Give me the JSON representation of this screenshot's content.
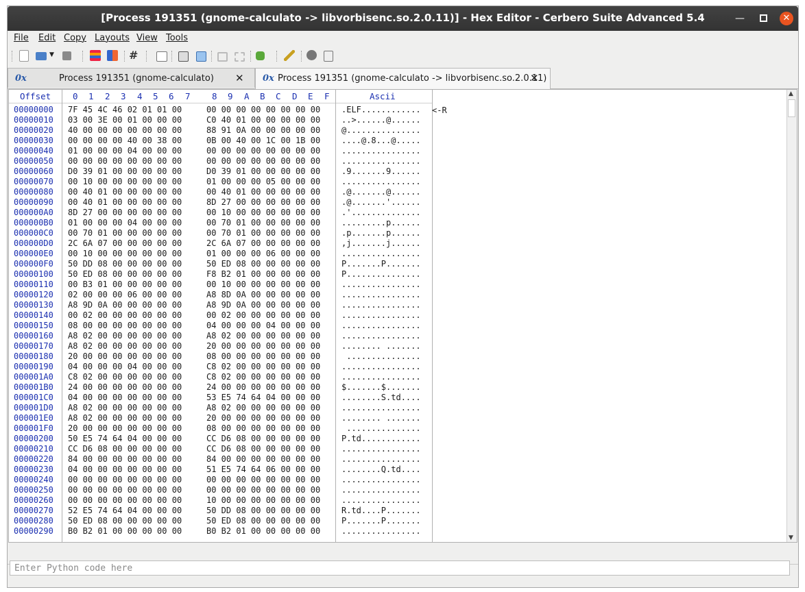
{
  "window": {
    "title": "[Process 191351 (gnome-calculato -> libvorbisenc.so.2.0.11)] - Hex Editor - Cerbero Suite Advanced 5.4"
  },
  "menu": [
    "File",
    "Edit",
    "Copy",
    "Layouts",
    "View",
    "Tools"
  ],
  "toolbar": {
    "icons": [
      "new-file-icon",
      "open-folder-icon",
      "dropdown-arrow-icon",
      "save-icon",
      "color-bars-icon",
      "color-grid-icon",
      "hash-icon",
      "window-icon",
      "save-alt-icon",
      "save-image-icon",
      "frame-icon",
      "frame-alt-icon",
      "puzzle-icon",
      "wand-icon",
      "gear-icon",
      "settings-file-icon"
    ]
  },
  "tabs": [
    {
      "icon": "0x",
      "label": "Process 191351 (gnome-calculato)",
      "close": "✕"
    },
    {
      "icon": "0x",
      "label": "Process 191351 (gnome-calculato -> libvorbisenc.so.2.0.11)",
      "close": "✕"
    }
  ],
  "hex": {
    "header": {
      "offset": "Offset",
      "cols": [
        "0",
        "1",
        "2",
        "3",
        "4",
        "5",
        "6",
        "7",
        "8",
        "9",
        "A",
        "B",
        "C",
        "D",
        "E",
        "F"
      ],
      "ascii": "Ascii"
    },
    "annotation": "<-R",
    "rows": [
      {
        "o": "00000000",
        "a": "7F 45 4C 46 02 01 01 00",
        "b": "00 00 00 00 00 00 00 00",
        "s": ".ELF............"
      },
      {
        "o": "00000010",
        "a": "03 00 3E 00 01 00 00 00",
        "b": "C0 40 01 00 00 00 00 00",
        "s": "..>......@......"
      },
      {
        "o": "00000020",
        "a": "40 00 00 00 00 00 00 00",
        "b": "88 91 0A 00 00 00 00 00",
        "s": "@..............."
      },
      {
        "o": "00000030",
        "a": "00 00 00 00 40 00 38 00",
        "b": "0B 00 40 00 1C 00 1B 00",
        "s": "....@.8...@....."
      },
      {
        "o": "00000040",
        "a": "01 00 00 00 04 00 00 00",
        "b": "00 00 00 00 00 00 00 00",
        "s": "................"
      },
      {
        "o": "00000050",
        "a": "00 00 00 00 00 00 00 00",
        "b": "00 00 00 00 00 00 00 00",
        "s": "................"
      },
      {
        "o": "00000060",
        "a": "D0 39 01 00 00 00 00 00",
        "b": "D0 39 01 00 00 00 00 00",
        "s": ".9.......9......"
      },
      {
        "o": "00000070",
        "a": "00 10 00 00 00 00 00 00",
        "b": "01 00 00 00 05 00 00 00",
        "s": "................"
      },
      {
        "o": "00000080",
        "a": "00 40 01 00 00 00 00 00",
        "b": "00 40 01 00 00 00 00 00",
        "s": ".@.......@......"
      },
      {
        "o": "00000090",
        "a": "00 40 01 00 00 00 00 00",
        "b": "8D 27 00 00 00 00 00 00",
        "s": ".@.......'......"
      },
      {
        "o": "000000A0",
        "a": "8D 27 00 00 00 00 00 00",
        "b": "00 10 00 00 00 00 00 00",
        "s": ".'.............."
      },
      {
        "o": "000000B0",
        "a": "01 00 00 00 04 00 00 00",
        "b": "00 70 01 00 00 00 00 00",
        "s": ".........p......"
      },
      {
        "o": "000000C0",
        "a": "00 70 01 00 00 00 00 00",
        "b": "00 70 01 00 00 00 00 00",
        "s": ".p.......p......"
      },
      {
        "o": "000000D0",
        "a": "2C 6A 07 00 00 00 00 00",
        "b": "2C 6A 07 00 00 00 00 00",
        "s": ",j.......j......"
      },
      {
        "o": "000000E0",
        "a": "00 10 00 00 00 00 00 00",
        "b": "01 00 00 00 06 00 00 00",
        "s": "................"
      },
      {
        "o": "000000F0",
        "a": "50 DD 08 00 00 00 00 00",
        "b": "50 ED 08 00 00 00 00 00",
        "s": "P.......P......."
      },
      {
        "o": "00000100",
        "a": "50 ED 08 00 00 00 00 00",
        "b": "F8 B2 01 00 00 00 00 00",
        "s": "P..............."
      },
      {
        "o": "00000110",
        "a": "00 B3 01 00 00 00 00 00",
        "b": "00 10 00 00 00 00 00 00",
        "s": "................"
      },
      {
        "o": "00000120",
        "a": "02 00 00 00 06 00 00 00",
        "b": "A8 8D 0A 00 00 00 00 00",
        "s": "................"
      },
      {
        "o": "00000130",
        "a": "A8 9D 0A 00 00 00 00 00",
        "b": "A8 9D 0A 00 00 00 00 00",
        "s": "................"
      },
      {
        "o": "00000140",
        "a": "00 02 00 00 00 00 00 00",
        "b": "00 02 00 00 00 00 00 00",
        "s": "................"
      },
      {
        "o": "00000150",
        "a": "08 00 00 00 00 00 00 00",
        "b": "04 00 00 00 04 00 00 00",
        "s": "................"
      },
      {
        "o": "00000160",
        "a": "A8 02 00 00 00 00 00 00",
        "b": "A8 02 00 00 00 00 00 00",
        "s": "................"
      },
      {
        "o": "00000170",
        "a": "A8 02 00 00 00 00 00 00",
        "b": "20 00 00 00 00 00 00 00",
        "s": "........ ......."
      },
      {
        "o": "00000180",
        "a": "20 00 00 00 00 00 00 00",
        "b": "08 00 00 00 00 00 00 00",
        "s": " ..............."
      },
      {
        "o": "00000190",
        "a": "04 00 00 00 04 00 00 00",
        "b": "C8 02 00 00 00 00 00 00",
        "s": "................"
      },
      {
        "o": "000001A0",
        "a": "C8 02 00 00 00 00 00 00",
        "b": "C8 02 00 00 00 00 00 00",
        "s": "................"
      },
      {
        "o": "000001B0",
        "a": "24 00 00 00 00 00 00 00",
        "b": "24 00 00 00 00 00 00 00",
        "s": "$.......$......."
      },
      {
        "o": "000001C0",
        "a": "04 00 00 00 00 00 00 00",
        "b": "53 E5 74 64 04 00 00 00",
        "s": "........S.td...."
      },
      {
        "o": "000001D0",
        "a": "A8 02 00 00 00 00 00 00",
        "b": "A8 02 00 00 00 00 00 00",
        "s": "................"
      },
      {
        "o": "000001E0",
        "a": "A8 02 00 00 00 00 00 00",
        "b": "20 00 00 00 00 00 00 00",
        "s": "........ ......."
      },
      {
        "o": "000001F0",
        "a": "20 00 00 00 00 00 00 00",
        "b": "08 00 00 00 00 00 00 00",
        "s": " ..............."
      },
      {
        "o": "00000200",
        "a": "50 E5 74 64 04 00 00 00",
        "b": "CC D6 08 00 00 00 00 00",
        "s": "P.td............"
      },
      {
        "o": "00000210",
        "a": "CC D6 08 00 00 00 00 00",
        "b": "CC D6 08 00 00 00 00 00",
        "s": "................"
      },
      {
        "o": "00000220",
        "a": "84 00 00 00 00 00 00 00",
        "b": "84 00 00 00 00 00 00 00",
        "s": "................"
      },
      {
        "o": "00000230",
        "a": "04 00 00 00 00 00 00 00",
        "b": "51 E5 74 64 06 00 00 00",
        "s": "........Q.td...."
      },
      {
        "o": "00000240",
        "a": "00 00 00 00 00 00 00 00",
        "b": "00 00 00 00 00 00 00 00",
        "s": "................"
      },
      {
        "o": "00000250",
        "a": "00 00 00 00 00 00 00 00",
        "b": "00 00 00 00 00 00 00 00",
        "s": "................"
      },
      {
        "o": "00000260",
        "a": "00 00 00 00 00 00 00 00",
        "b": "10 00 00 00 00 00 00 00",
        "s": "................"
      },
      {
        "o": "00000270",
        "a": "52 E5 74 64 04 00 00 00",
        "b": "50 DD 08 00 00 00 00 00",
        "s": "R.td....P......."
      },
      {
        "o": "00000280",
        "a": "50 ED 08 00 00 00 00 00",
        "b": "50 ED 08 00 00 00 00 00",
        "s": "P.......P......."
      },
      {
        "o": "00000290",
        "a": "B0 B2 01 00 00 00 00 00",
        "b": "B0 B2 01 00 00 00 00 00",
        "s": "................"
      }
    ]
  },
  "python": {
    "placeholder": "Enter Python code here"
  },
  "colors": {
    "offset": "#1a2fb0",
    "titlebar": "#383838",
    "close": "#e95420",
    "tab_icon": "#2a5aa8"
  }
}
